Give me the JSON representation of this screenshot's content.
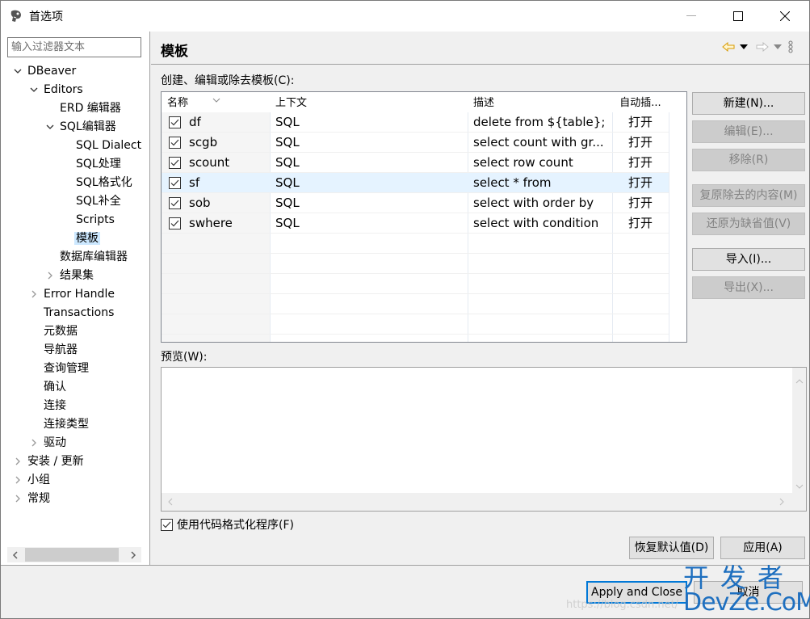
{
  "window": {
    "title": "首选项",
    "controls": {
      "minimize": "minimize",
      "maximize": "maximize",
      "close": "close"
    }
  },
  "sidebar": {
    "filter_placeholder": "输入过滤器文本",
    "tree": [
      {
        "label": "DBeaver",
        "level": 0,
        "expander": "expanded"
      },
      {
        "label": "Editors",
        "level": 1,
        "expander": "expanded"
      },
      {
        "label": "ERD 编辑器",
        "level": 2,
        "expander": "none"
      },
      {
        "label": "SQL编辑器",
        "level": 2,
        "expander": "expanded"
      },
      {
        "label": "SQL Dialect",
        "level": 3,
        "expander": "none"
      },
      {
        "label": "SQL处理",
        "level": 3,
        "expander": "none"
      },
      {
        "label": "SQL格式化",
        "level": 3,
        "expander": "none"
      },
      {
        "label": "SQL补全",
        "level": 3,
        "expander": "none"
      },
      {
        "label": "Scripts",
        "level": 3,
        "expander": "none"
      },
      {
        "label": "模板",
        "level": 3,
        "expander": "none",
        "selected": true
      },
      {
        "label": "数据库编辑器",
        "level": 2,
        "expander": "none"
      },
      {
        "label": "结果集",
        "level": 2,
        "expander": "collapsed"
      },
      {
        "label": "Error Handle",
        "level": 1,
        "expander": "collapsed"
      },
      {
        "label": "Transactions",
        "level": 1,
        "expander": "none"
      },
      {
        "label": "元数据",
        "level": 1,
        "expander": "none"
      },
      {
        "label": "导航器",
        "level": 1,
        "expander": "none"
      },
      {
        "label": "查询管理",
        "level": 1,
        "expander": "none"
      },
      {
        "label": "确认",
        "level": 1,
        "expander": "none"
      },
      {
        "label": "连接",
        "level": 1,
        "expander": "none"
      },
      {
        "label": "连接类型",
        "level": 1,
        "expander": "none"
      },
      {
        "label": "驱动",
        "level": 1,
        "expander": "collapsed"
      },
      {
        "label": "安装 / 更新",
        "level": 0,
        "expander": "collapsed"
      },
      {
        "label": "小组",
        "level": 0,
        "expander": "collapsed"
      },
      {
        "label": "常规",
        "level": 0,
        "expander": "collapsed"
      }
    ]
  },
  "page": {
    "title": "模板",
    "nav": {
      "back": "back-arrow",
      "forward": "forward-arrow",
      "menu": "view-menu"
    },
    "templates_label": "创建、编辑或除去模板(C):",
    "table": {
      "columns": [
        "名称",
        "上下文",
        "描述",
        "自动插..."
      ],
      "rows": [
        {
          "checked": true,
          "name": "df",
          "context": "SQL",
          "description": "delete from ${table};",
          "auto_insert": "打开"
        },
        {
          "checked": true,
          "name": "scgb",
          "context": "SQL",
          "description": "select count with gr...",
          "auto_insert": "打开"
        },
        {
          "checked": true,
          "name": "scount",
          "context": "SQL",
          "description": "select row count",
          "auto_insert": "打开"
        },
        {
          "checked": true,
          "name": "sf",
          "context": "SQL",
          "description": "select * from",
          "auto_insert": "打开",
          "selected": true
        },
        {
          "checked": true,
          "name": "sob",
          "context": "SQL",
          "description": "select with order by",
          "auto_insert": "打开"
        },
        {
          "checked": true,
          "name": "swhere",
          "context": "SQL",
          "description": "select with condition",
          "auto_insert": "打开"
        }
      ]
    },
    "side_buttons": [
      {
        "label": "新建(N)...",
        "enabled": true
      },
      {
        "label": "编辑(E)...",
        "enabled": false
      },
      {
        "label": "移除(R)",
        "enabled": false
      },
      {
        "label": "复原除去的内容(M)",
        "enabled": false
      },
      {
        "label": "还原为缺省值(V)",
        "enabled": false
      },
      {
        "label": "导入(I)...",
        "enabled": true
      },
      {
        "label": "导出(X)...",
        "enabled": false
      }
    ],
    "preview_label": "预览(W):",
    "preview_text": "",
    "use_formatter": {
      "label": "使用代码格式化程序(F)",
      "checked": true
    },
    "restore_defaults": "恢复默认值(D)",
    "apply": "应用(A)"
  },
  "footer": {
    "apply_and_close": "Apply and Close",
    "cancel": "取消"
  },
  "watermark": {
    "top": "开发者",
    "bottom": "DevZe.CoM",
    "url": "https://blog.csdn.net/"
  }
}
